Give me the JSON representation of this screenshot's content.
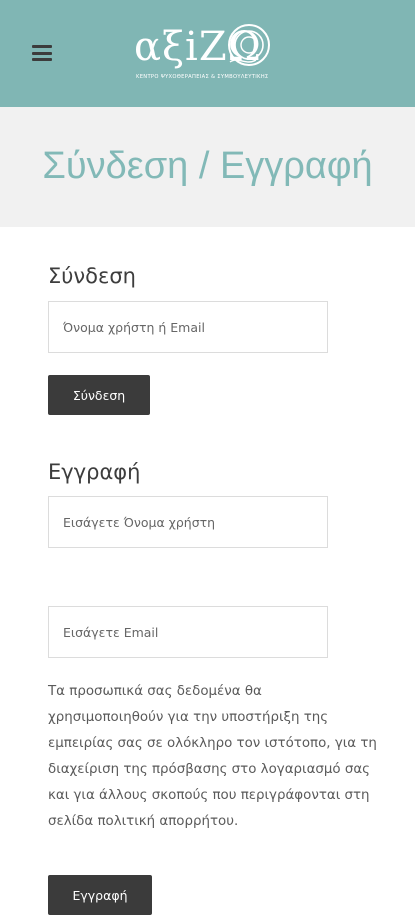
{
  "header": {
    "logo_text": "αξiΖΩ",
    "logo_subtitle": "ΚΕΝΤΡΟ ΨΥΧΟΘΕΡΑΠΕΙΑΣ & ΣΥΜΒΟΥΛΕΥΤΙΚΗΣ",
    "menu_icon": "hamburger-icon"
  },
  "page": {
    "title": "Σύνδεση / Εγγραφή"
  },
  "login": {
    "heading": "Σύνδεση",
    "username_placeholder": "Όνομα χρήστη ή Email",
    "submit_label": "Σύνδεση"
  },
  "register": {
    "heading": "Εγγραφή",
    "username_placeholder": "Εισάγετε Όνομα χρήστη",
    "email_placeholder": "Εισάγετε Email",
    "privacy_text": "Τα προσωπικά σας δεδομένα θα χρησιμοποιηθούν για την υποστήριξη της εμπειρίας σας σε ολόκληρο τον ιστότοπο, για τη διαχείριση της πρόσβασης στο λογαριασμό σας και για άλλους σκοπούς που περιγράφονται στη σελίδα πολιτική απορρήτου.",
    "submit_label": "Εγγραφή"
  },
  "colors": {
    "header_bg": "#80b6b4",
    "title_color": "#82b9b7",
    "title_band_bg": "#f1f1f1",
    "button_bg": "#3b3b3b"
  }
}
